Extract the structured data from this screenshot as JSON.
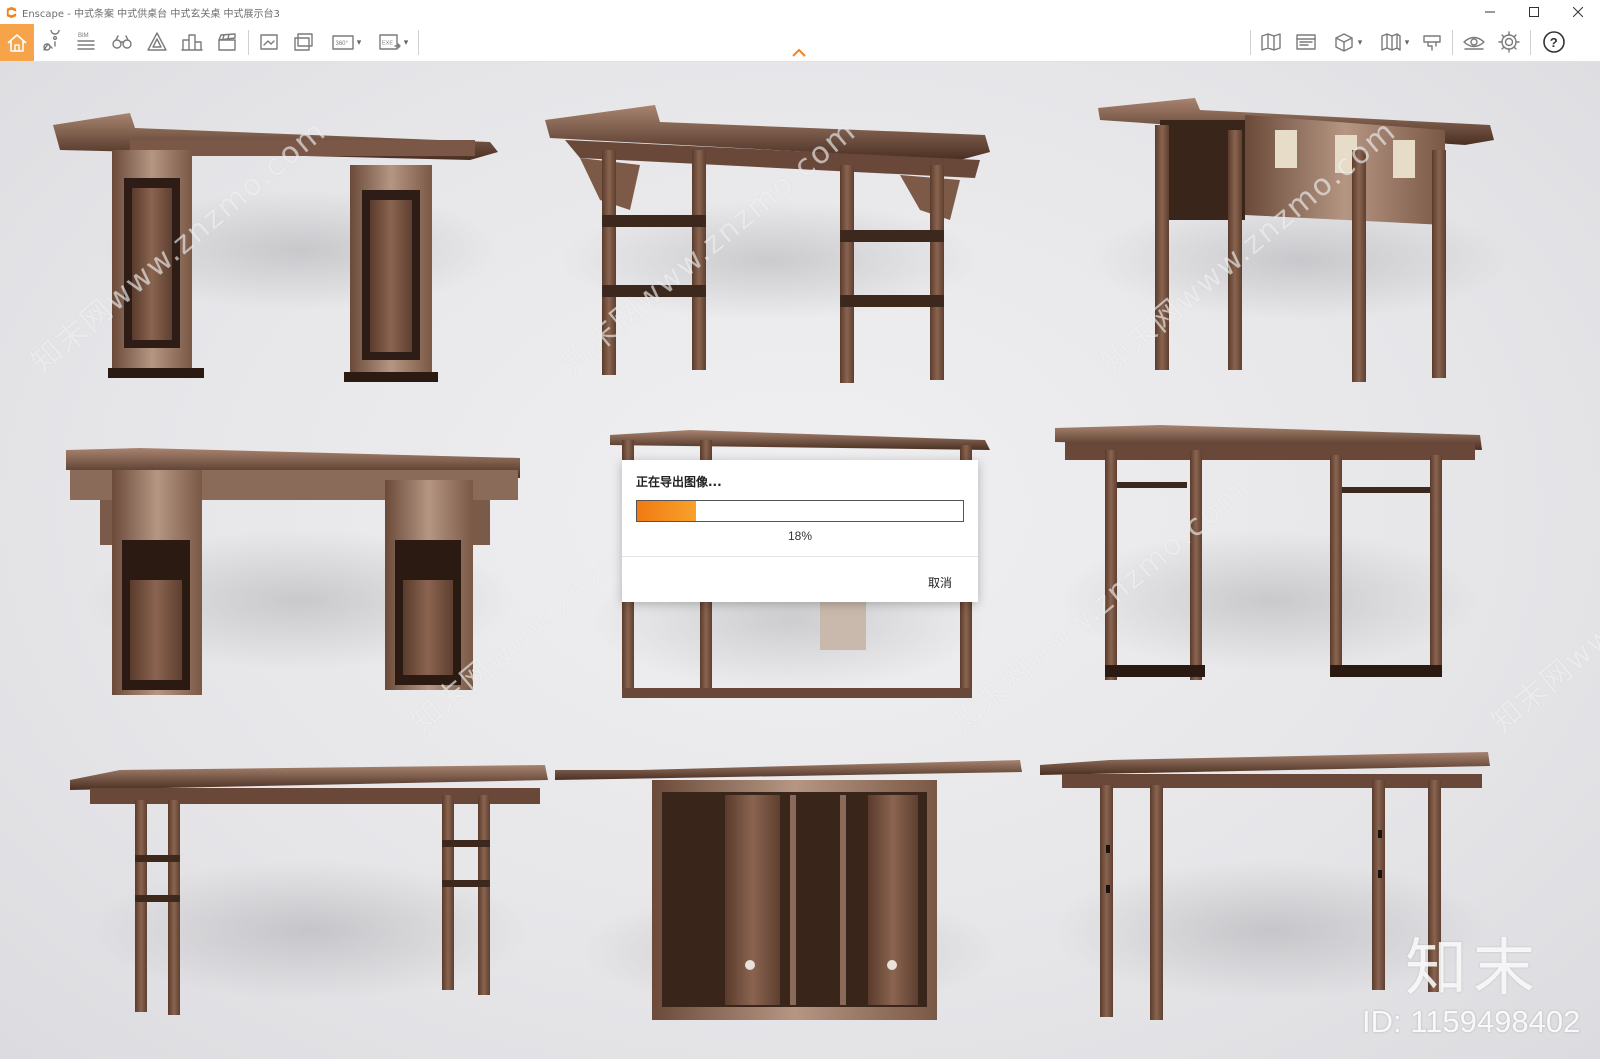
{
  "window": {
    "title": "Enscape - 中式条案 中式供桌台 中式玄关桌 中式展示台3",
    "controls": [
      "minimize-icon",
      "maximize-icon",
      "close-icon"
    ]
  },
  "toolbar": {
    "left_icons": [
      "home-icon",
      "location-pin-icon",
      "bim-icon",
      "binoculars-icon",
      "asset-library-icon",
      "buildings-icon",
      "clapper-icon",
      "screenshot-icon",
      "batch-render-icon",
      "panorama-360-icon",
      "exe-export-icon"
    ],
    "bim_label": "BIM",
    "panorama_label": "360°",
    "exe_label": "EXE",
    "right_icons": [
      "map-icon",
      "render-window-icon",
      "box-icon",
      "book-icon",
      "material-icon",
      "eye-icon",
      "settings-icon",
      "help-icon"
    ],
    "help_label": "?"
  },
  "accent_color": "#f6a34a",
  "progress_color": "#f07a12",
  "dialog": {
    "title": "正在导出图像...",
    "progress": 0.18,
    "percent_text": "18%",
    "cancel_label": "取消"
  },
  "watermark": {
    "text": "知末网www.znzmo.com",
    "logo": "知末",
    "id": "ID: 1159498402"
  }
}
